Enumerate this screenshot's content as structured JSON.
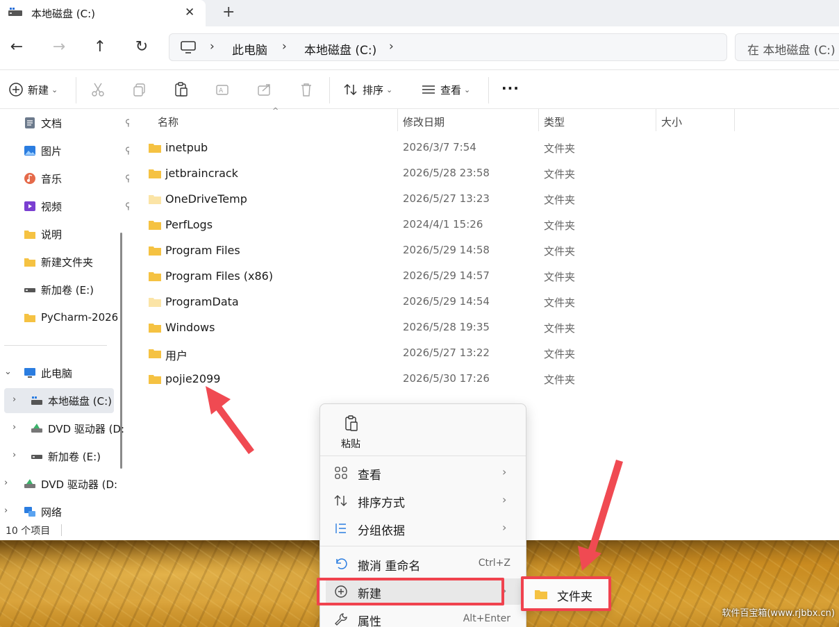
{
  "tab": {
    "title": "本地磁盘 (C:)",
    "close": "✕",
    "new": "+"
  },
  "nav": {
    "back": "←",
    "forward": "→",
    "up": "↑",
    "refresh": "↻"
  },
  "breadcrumb": {
    "sep": "›",
    "items": [
      "此电脑",
      "本地磁盘 (C:)"
    ]
  },
  "search": {
    "placeholder": "在 本地磁盘 (C:) 中"
  },
  "toolbar": {
    "new_label": "新建",
    "sort_label": "排序",
    "view_label": "查看",
    "more": "···",
    "caret": "⌄"
  },
  "sidebar": {
    "pinned": [
      {
        "label": "文档"
      },
      {
        "label": "图片"
      },
      {
        "label": "音乐"
      },
      {
        "label": "视频"
      }
    ],
    "folders": [
      {
        "label": "说明"
      },
      {
        "label": "新建文件夹"
      },
      {
        "label": "新加卷 (E:)"
      },
      {
        "label": "PyCharm-2026"
      }
    ],
    "tree": [
      {
        "label": "此电脑"
      },
      {
        "label": "本地磁盘 (C:)"
      },
      {
        "label": "DVD 驱动器 (D:"
      },
      {
        "label": "新加卷 (E:)"
      },
      {
        "label": "DVD 驱动器 (D:"
      },
      {
        "label": "网络"
      }
    ],
    "chev_right": "›",
    "chev_down": "⌄",
    "pin": "📌"
  },
  "columns": {
    "name": "名称",
    "date": "修改日期",
    "type": "类型",
    "size": "大小",
    "sort_indicator": "^"
  },
  "files": [
    {
      "name": "inetpub",
      "date": "2026/3/7 7:54",
      "type": "文件夹",
      "light": false
    },
    {
      "name": "jetbraincrack",
      "date": "2026/5/28 23:58",
      "type": "文件夹",
      "light": false
    },
    {
      "name": "OneDriveTemp",
      "date": "2026/5/27 13:23",
      "type": "文件夹",
      "light": true
    },
    {
      "name": "PerfLogs",
      "date": "2024/4/1 15:26",
      "type": "文件夹",
      "light": false
    },
    {
      "name": "Program Files",
      "date": "2026/5/29 14:58",
      "type": "文件夹",
      "light": false
    },
    {
      "name": "Program Files (x86)",
      "date": "2026/5/29 14:57",
      "type": "文件夹",
      "light": false
    },
    {
      "name": "ProgramData",
      "date": "2026/5/29 14:54",
      "type": "文件夹",
      "light": true
    },
    {
      "name": "Windows",
      "date": "2026/5/28 19:35",
      "type": "文件夹",
      "light": false
    },
    {
      "name": "用户",
      "date": "2026/5/27 13:22",
      "type": "文件夹",
      "light": false
    },
    {
      "name": "pojie2099",
      "date": "2026/5/30 17:26",
      "type": "文件夹",
      "light": false
    }
  ],
  "status": {
    "count": "10 个项目"
  },
  "context_menu": {
    "paste_label": "粘贴",
    "view_label": "查看",
    "sort_label": "排序方式",
    "group_label": "分组依据",
    "undo_label": "撤消 重命名",
    "undo_shortcut": "Ctrl+Z",
    "new_label": "新建",
    "props_label": "属性",
    "props_shortcut": "Alt+Enter",
    "arrow": "›"
  },
  "submenu": {
    "folder_label": "文件夹"
  },
  "watermark": "软件百宝箱(www.rjbbx.cn)",
  "colors": {
    "accent": "#f0424e",
    "folder": "#f5c242",
    "folder_light": "#fbe4a6",
    "selected": "#e6e9ee"
  }
}
